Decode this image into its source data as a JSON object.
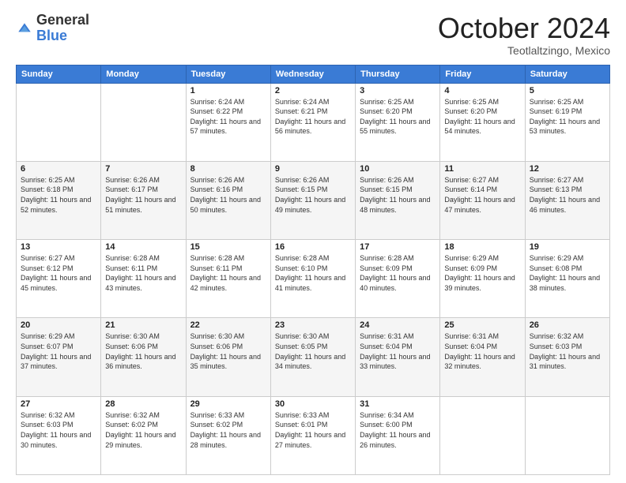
{
  "header": {
    "logo_general": "General",
    "logo_blue": "Blue",
    "title": "October 2024",
    "location": "Teotlaltzingo, Mexico"
  },
  "calendar": {
    "days_of_week": [
      "Sunday",
      "Monday",
      "Tuesday",
      "Wednesday",
      "Thursday",
      "Friday",
      "Saturday"
    ],
    "weeks": [
      [
        {
          "day": "",
          "sunrise": "",
          "sunset": "",
          "daylight": ""
        },
        {
          "day": "",
          "sunrise": "",
          "sunset": "",
          "daylight": ""
        },
        {
          "day": "1",
          "sunrise": "Sunrise: 6:24 AM",
          "sunset": "Sunset: 6:22 PM",
          "daylight": "Daylight: 11 hours and 57 minutes."
        },
        {
          "day": "2",
          "sunrise": "Sunrise: 6:24 AM",
          "sunset": "Sunset: 6:21 PM",
          "daylight": "Daylight: 11 hours and 56 minutes."
        },
        {
          "day": "3",
          "sunrise": "Sunrise: 6:25 AM",
          "sunset": "Sunset: 6:20 PM",
          "daylight": "Daylight: 11 hours and 55 minutes."
        },
        {
          "day": "4",
          "sunrise": "Sunrise: 6:25 AM",
          "sunset": "Sunset: 6:20 PM",
          "daylight": "Daylight: 11 hours and 54 minutes."
        },
        {
          "day": "5",
          "sunrise": "Sunrise: 6:25 AM",
          "sunset": "Sunset: 6:19 PM",
          "daylight": "Daylight: 11 hours and 53 minutes."
        }
      ],
      [
        {
          "day": "6",
          "sunrise": "Sunrise: 6:25 AM",
          "sunset": "Sunset: 6:18 PM",
          "daylight": "Daylight: 11 hours and 52 minutes."
        },
        {
          "day": "7",
          "sunrise": "Sunrise: 6:26 AM",
          "sunset": "Sunset: 6:17 PM",
          "daylight": "Daylight: 11 hours and 51 minutes."
        },
        {
          "day": "8",
          "sunrise": "Sunrise: 6:26 AM",
          "sunset": "Sunset: 6:16 PM",
          "daylight": "Daylight: 11 hours and 50 minutes."
        },
        {
          "day": "9",
          "sunrise": "Sunrise: 6:26 AM",
          "sunset": "Sunset: 6:15 PM",
          "daylight": "Daylight: 11 hours and 49 minutes."
        },
        {
          "day": "10",
          "sunrise": "Sunrise: 6:26 AM",
          "sunset": "Sunset: 6:15 PM",
          "daylight": "Daylight: 11 hours and 48 minutes."
        },
        {
          "day": "11",
          "sunrise": "Sunrise: 6:27 AM",
          "sunset": "Sunset: 6:14 PM",
          "daylight": "Daylight: 11 hours and 47 minutes."
        },
        {
          "day": "12",
          "sunrise": "Sunrise: 6:27 AM",
          "sunset": "Sunset: 6:13 PM",
          "daylight": "Daylight: 11 hours and 46 minutes."
        }
      ],
      [
        {
          "day": "13",
          "sunrise": "Sunrise: 6:27 AM",
          "sunset": "Sunset: 6:12 PM",
          "daylight": "Daylight: 11 hours and 45 minutes."
        },
        {
          "day": "14",
          "sunrise": "Sunrise: 6:28 AM",
          "sunset": "Sunset: 6:11 PM",
          "daylight": "Daylight: 11 hours and 43 minutes."
        },
        {
          "day": "15",
          "sunrise": "Sunrise: 6:28 AM",
          "sunset": "Sunset: 6:11 PM",
          "daylight": "Daylight: 11 hours and 42 minutes."
        },
        {
          "day": "16",
          "sunrise": "Sunrise: 6:28 AM",
          "sunset": "Sunset: 6:10 PM",
          "daylight": "Daylight: 11 hours and 41 minutes."
        },
        {
          "day": "17",
          "sunrise": "Sunrise: 6:28 AM",
          "sunset": "Sunset: 6:09 PM",
          "daylight": "Daylight: 11 hours and 40 minutes."
        },
        {
          "day": "18",
          "sunrise": "Sunrise: 6:29 AM",
          "sunset": "Sunset: 6:09 PM",
          "daylight": "Daylight: 11 hours and 39 minutes."
        },
        {
          "day": "19",
          "sunrise": "Sunrise: 6:29 AM",
          "sunset": "Sunset: 6:08 PM",
          "daylight": "Daylight: 11 hours and 38 minutes."
        }
      ],
      [
        {
          "day": "20",
          "sunrise": "Sunrise: 6:29 AM",
          "sunset": "Sunset: 6:07 PM",
          "daylight": "Daylight: 11 hours and 37 minutes."
        },
        {
          "day": "21",
          "sunrise": "Sunrise: 6:30 AM",
          "sunset": "Sunset: 6:06 PM",
          "daylight": "Daylight: 11 hours and 36 minutes."
        },
        {
          "day": "22",
          "sunrise": "Sunrise: 6:30 AM",
          "sunset": "Sunset: 6:06 PM",
          "daylight": "Daylight: 11 hours and 35 minutes."
        },
        {
          "day": "23",
          "sunrise": "Sunrise: 6:30 AM",
          "sunset": "Sunset: 6:05 PM",
          "daylight": "Daylight: 11 hours and 34 minutes."
        },
        {
          "day": "24",
          "sunrise": "Sunrise: 6:31 AM",
          "sunset": "Sunset: 6:04 PM",
          "daylight": "Daylight: 11 hours and 33 minutes."
        },
        {
          "day": "25",
          "sunrise": "Sunrise: 6:31 AM",
          "sunset": "Sunset: 6:04 PM",
          "daylight": "Daylight: 11 hours and 32 minutes."
        },
        {
          "day": "26",
          "sunrise": "Sunrise: 6:32 AM",
          "sunset": "Sunset: 6:03 PM",
          "daylight": "Daylight: 11 hours and 31 minutes."
        }
      ],
      [
        {
          "day": "27",
          "sunrise": "Sunrise: 6:32 AM",
          "sunset": "Sunset: 6:03 PM",
          "daylight": "Daylight: 11 hours and 30 minutes."
        },
        {
          "day": "28",
          "sunrise": "Sunrise: 6:32 AM",
          "sunset": "Sunset: 6:02 PM",
          "daylight": "Daylight: 11 hours and 29 minutes."
        },
        {
          "day": "29",
          "sunrise": "Sunrise: 6:33 AM",
          "sunset": "Sunset: 6:02 PM",
          "daylight": "Daylight: 11 hours and 28 minutes."
        },
        {
          "day": "30",
          "sunrise": "Sunrise: 6:33 AM",
          "sunset": "Sunset: 6:01 PM",
          "daylight": "Daylight: 11 hours and 27 minutes."
        },
        {
          "day": "31",
          "sunrise": "Sunrise: 6:34 AM",
          "sunset": "Sunset: 6:00 PM",
          "daylight": "Daylight: 11 hours and 26 minutes."
        },
        {
          "day": "",
          "sunrise": "",
          "sunset": "",
          "daylight": ""
        },
        {
          "day": "",
          "sunrise": "",
          "sunset": "",
          "daylight": ""
        }
      ]
    ]
  }
}
